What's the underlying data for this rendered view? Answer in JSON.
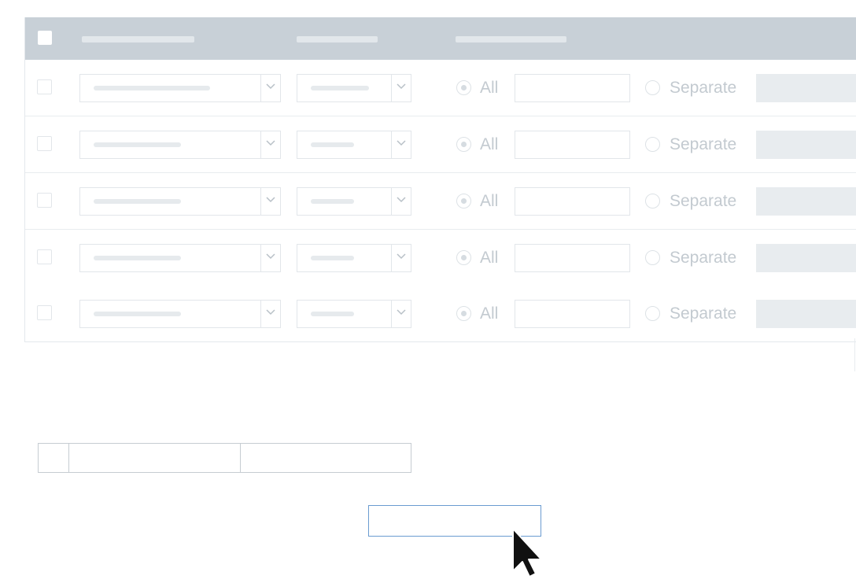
{
  "table": {
    "rows": [
      {
        "all_label": "All",
        "separate_label": "Separate",
        "all_selected": true
      },
      {
        "all_label": "All",
        "separate_label": "Separate",
        "all_selected": true
      },
      {
        "all_label": "All",
        "separate_label": "Separate",
        "all_selected": true
      },
      {
        "all_label": "All",
        "separate_label": "Separate",
        "all_selected": true
      },
      {
        "all_label": "All",
        "separate_label": "Separate",
        "all_selected": true
      }
    ]
  },
  "icons": {
    "select_arrow": "chevron-down-icon",
    "cursor": "mouse-pointer-icon"
  },
  "colors": {
    "header_bg": "#c8d0d7",
    "focus_border": "#6a9bd0"
  }
}
